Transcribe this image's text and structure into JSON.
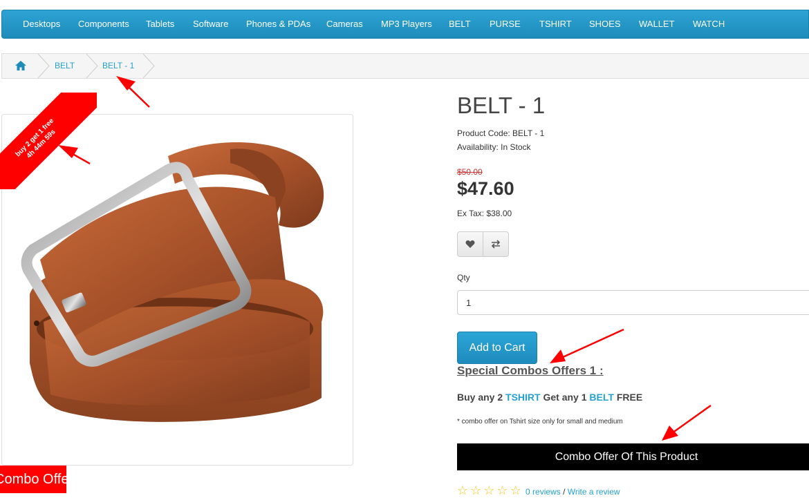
{
  "nav": {
    "items": [
      "Desktops",
      "Components",
      "Tablets",
      "Software",
      "Phones & PDAs",
      "Cameras",
      "MP3 Players",
      "BELT",
      "PURSE",
      "TSHIRT",
      "SHOES",
      "WALLET",
      "WATCH"
    ]
  },
  "breadcrumb": {
    "home_icon": "home-icon",
    "items": [
      "BELT",
      "BELT - 1"
    ]
  },
  "image": {
    "ribbon_line1": "buy 2 get 1 free",
    "ribbon_line2": "4h 44m 59s",
    "combo_tab": "Combo Offer"
  },
  "product": {
    "title": "BELT - 1",
    "code_label": "Product Code: BELT - 1",
    "availability": "Availability: In Stock",
    "old_price": "$50.00",
    "price": "$47.60",
    "ex_tax": "Ex Tax: $38.00",
    "wishlist_icon": "heart-icon",
    "compare_icon": "exchange-icon",
    "qty_label": "Qty",
    "qty_value": "1",
    "add_to_cart": "Add to Cart"
  },
  "combos": {
    "heading": "Special Combos Offers 1 :",
    "offer_a": "Buy any 2",
    "offer_a_item": "TSHIRT",
    "offer_b": "Get any 1",
    "offer_b_item": "BELT",
    "offer_c": "FREE",
    "note": "* combo offer on Tshirt size only for small and medium",
    "button": "Combo Offer Of This Product"
  },
  "reviews": {
    "count": "0 reviews",
    "separator": "/",
    "write": "Write a review"
  },
  "colors": {
    "nav_blue": "#1d8cba",
    "link_blue": "#23a1d1",
    "annotation_red": "#ff0000"
  }
}
